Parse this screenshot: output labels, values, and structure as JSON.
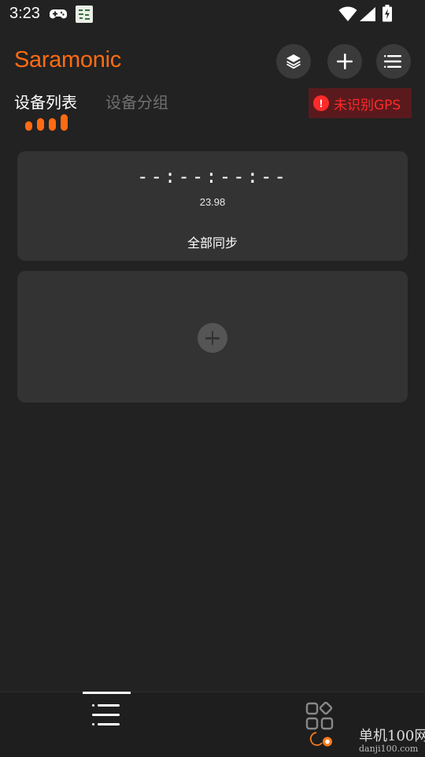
{
  "status_bar": {
    "time": "3:23",
    "icons": [
      "gamepad-icon",
      "app-notification-icon",
      "wifi-icon",
      "cell-signal-icon",
      "battery-charging-icon"
    ]
  },
  "header": {
    "brand": "Saramonic",
    "actions": [
      {
        "name": "layers",
        "icon": "layers-icon"
      },
      {
        "name": "add",
        "icon": "plus-icon"
      },
      {
        "name": "menu",
        "icon": "menu-lines-icon"
      }
    ]
  },
  "tabs": {
    "active": "设备列表",
    "inactive": "设备分组"
  },
  "gps_status": {
    "icon": "!",
    "text": "未识别GPS",
    "color": "#ff2a2a"
  },
  "sync_card": {
    "timecode": "--:--:--:--",
    "frame_rate": "23.98",
    "action_label": "全部同步"
  },
  "add_device_card": {
    "icon": "plus-circle-icon"
  },
  "bottom_nav": {
    "items": [
      {
        "name": "device-list",
        "icon": "list-icon",
        "active": true
      },
      {
        "name": "apps",
        "icon": "apps-grid-icon",
        "active": false
      }
    ]
  },
  "watermark": {
    "title": "单机100网",
    "url": "danji100.com"
  },
  "colors": {
    "accent": "#ff6b12",
    "background": "#222222",
    "card": "#333333",
    "warning": "#ff2a2a"
  }
}
